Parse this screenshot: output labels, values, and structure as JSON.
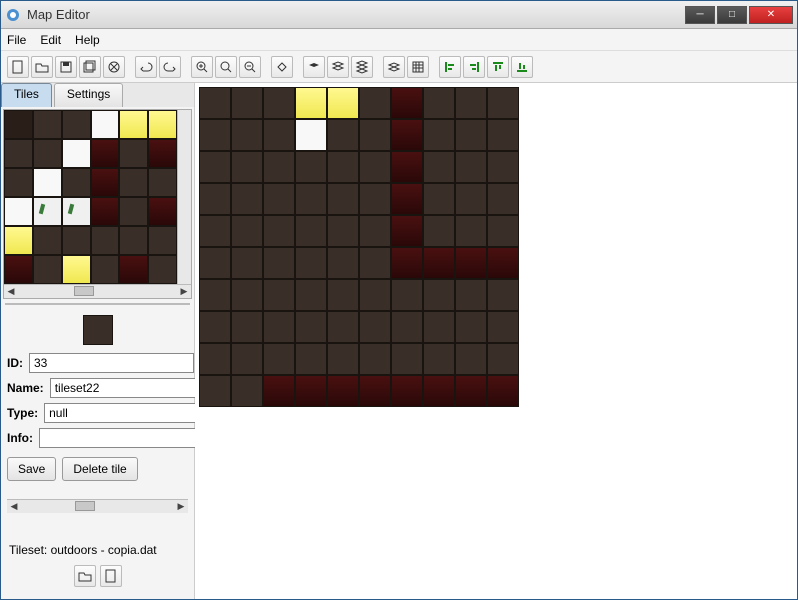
{
  "window": {
    "title": "Map Editor"
  },
  "menu": {
    "file": "File",
    "edit": "Edit",
    "help": "Help"
  },
  "tabs": {
    "tiles": "Tiles",
    "settings": "Settings",
    "active": "tiles"
  },
  "form": {
    "id_label": "ID:",
    "id_value": "33",
    "name_label": "Name:",
    "name_value": "tileset22",
    "type_label": "Type:",
    "type_value": "null",
    "info_label": "Info:",
    "info_value": ""
  },
  "buttons": {
    "save": "Save",
    "delete": "Delete tile"
  },
  "status": {
    "text": "Tileset: outdoors - copia.dat"
  },
  "palette_tiles": [
    "darker",
    "dark",
    "dark",
    "white",
    "yellow",
    "yellow",
    "dark",
    "dark",
    "white",
    "red",
    "dark",
    "red",
    "dark",
    "white",
    "dark",
    "red",
    "dark",
    "dark",
    "white",
    "grass",
    "grass",
    "red",
    "dark",
    "red",
    "yellow",
    "dark",
    "dark",
    "dark",
    "dark",
    "dark",
    "red",
    "dark",
    "yellow",
    "dark",
    "red",
    "dark"
  ],
  "map_tiles": [
    [
      "dark",
      "dark",
      "dark",
      "yellow",
      "yellow",
      "dark",
      "red",
      "dark",
      "dark",
      "dark"
    ],
    [
      "dark",
      "dark",
      "dark",
      "white",
      "dark",
      "dark",
      "red",
      "dark",
      "dark",
      "dark"
    ],
    [
      "dark",
      "dark",
      "dark",
      "dark",
      "dark",
      "dark",
      "red",
      "dark",
      "dark",
      "dark"
    ],
    [
      "dark",
      "dark",
      "dark",
      "dark",
      "dark",
      "dark",
      "red",
      "dark",
      "dark",
      "dark"
    ],
    [
      "dark",
      "dark",
      "dark",
      "dark",
      "dark",
      "dark",
      "red",
      "dark",
      "dark",
      "dark"
    ],
    [
      "dark",
      "dark",
      "dark",
      "dark",
      "dark",
      "dark",
      "red",
      "red",
      "red",
      "red"
    ],
    [
      "dark",
      "dark",
      "dark",
      "dark",
      "dark",
      "dark",
      "dark",
      "dark",
      "dark",
      "dark"
    ],
    [
      "dark",
      "dark",
      "dark",
      "dark",
      "dark",
      "dark",
      "dark",
      "dark",
      "dark",
      "dark"
    ],
    [
      "dark",
      "dark",
      "dark",
      "dark",
      "dark",
      "dark",
      "dark",
      "dark",
      "dark",
      "dark"
    ],
    [
      "dark",
      "dark",
      "red",
      "red",
      "red",
      "red",
      "red",
      "red",
      "red",
      "red"
    ]
  ]
}
